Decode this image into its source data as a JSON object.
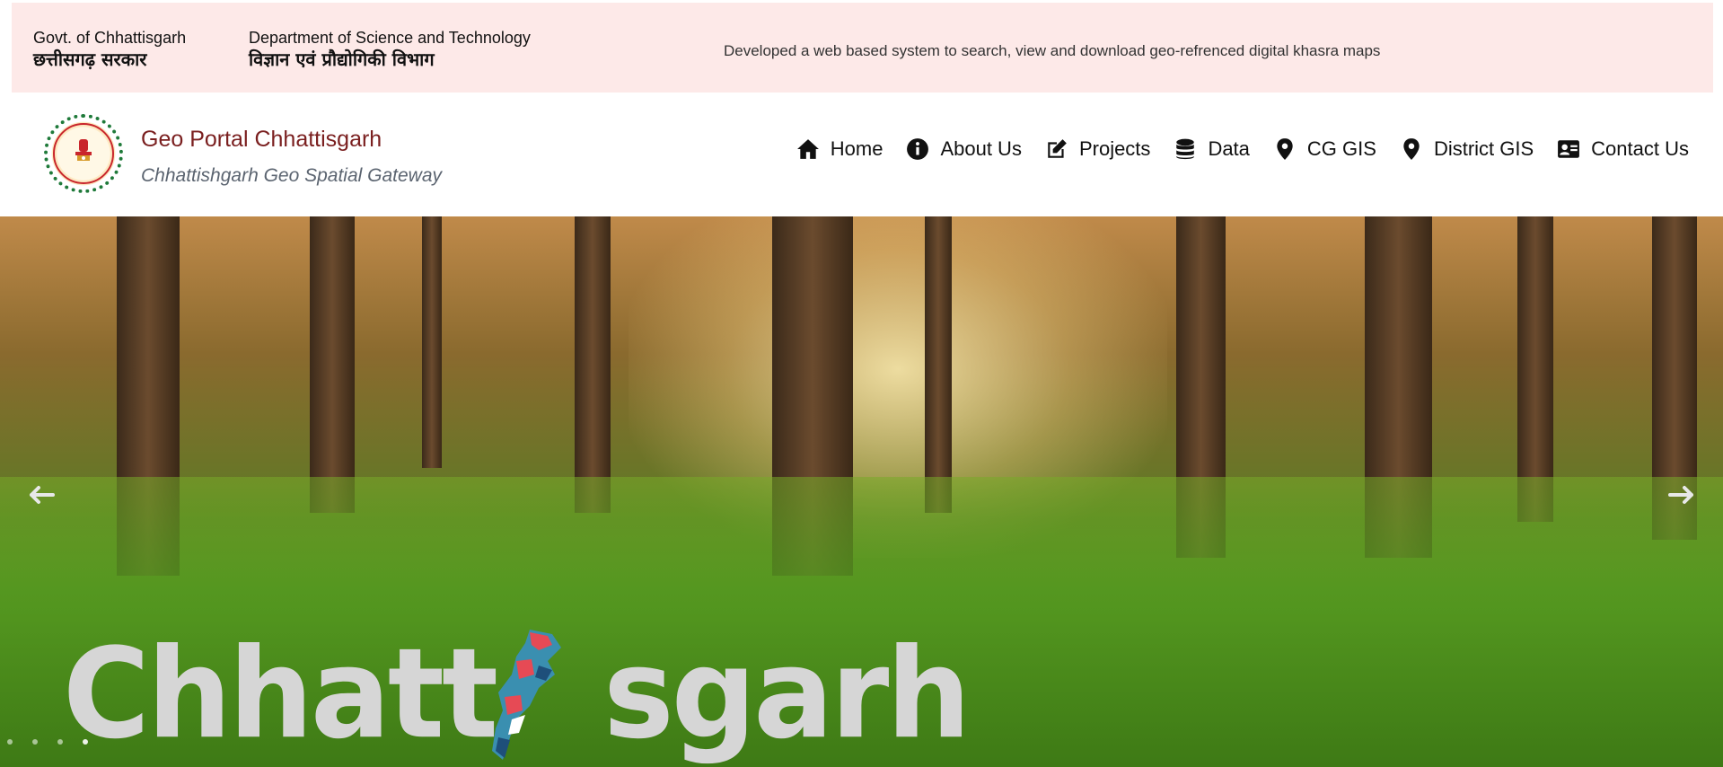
{
  "top_strip": {
    "govt_en": "Govt. of Chhattisgarh",
    "govt_hi": "छत्तीसगढ़ सरकार",
    "dept_en": "Department of Science and Technology",
    "dept_hi": "विज्ञान एवं प्रौद्योगिकी विभाग",
    "tagline": "Developed a web based system to search, view and download geo-refrenced digital khasra maps"
  },
  "header": {
    "title": "Geo Portal Chhattisgarh",
    "subtitle": "Chhattishgarh Geo Spatial Gateway",
    "emblem_icon": "state-emblem-icon"
  },
  "nav": {
    "items": [
      {
        "label": "Home",
        "icon": "home-icon"
      },
      {
        "label": "About Us",
        "icon": "info-icon"
      },
      {
        "label": "Projects",
        "icon": "edit-icon"
      },
      {
        "label": "Data",
        "icon": "database-icon"
      },
      {
        "label": "CG GIS",
        "icon": "map-marker-icon"
      },
      {
        "label": "District GIS",
        "icon": "map-marker-icon"
      },
      {
        "label": "Contact Us",
        "icon": "contact-card-icon"
      }
    ]
  },
  "hero": {
    "brand_left": "Chhatt",
    "brand_right": "sgarh",
    "prev_icon": "arrow-left-icon",
    "next_icon": "arrow-right-icon",
    "slide_count": 4,
    "active_slide": 4
  },
  "colors": {
    "top_strip_bg": "#fde9e8",
    "title_color": "#7a1f1f",
    "subtitle_color": "#5b6470",
    "brand_text": "#d6d6d6"
  }
}
